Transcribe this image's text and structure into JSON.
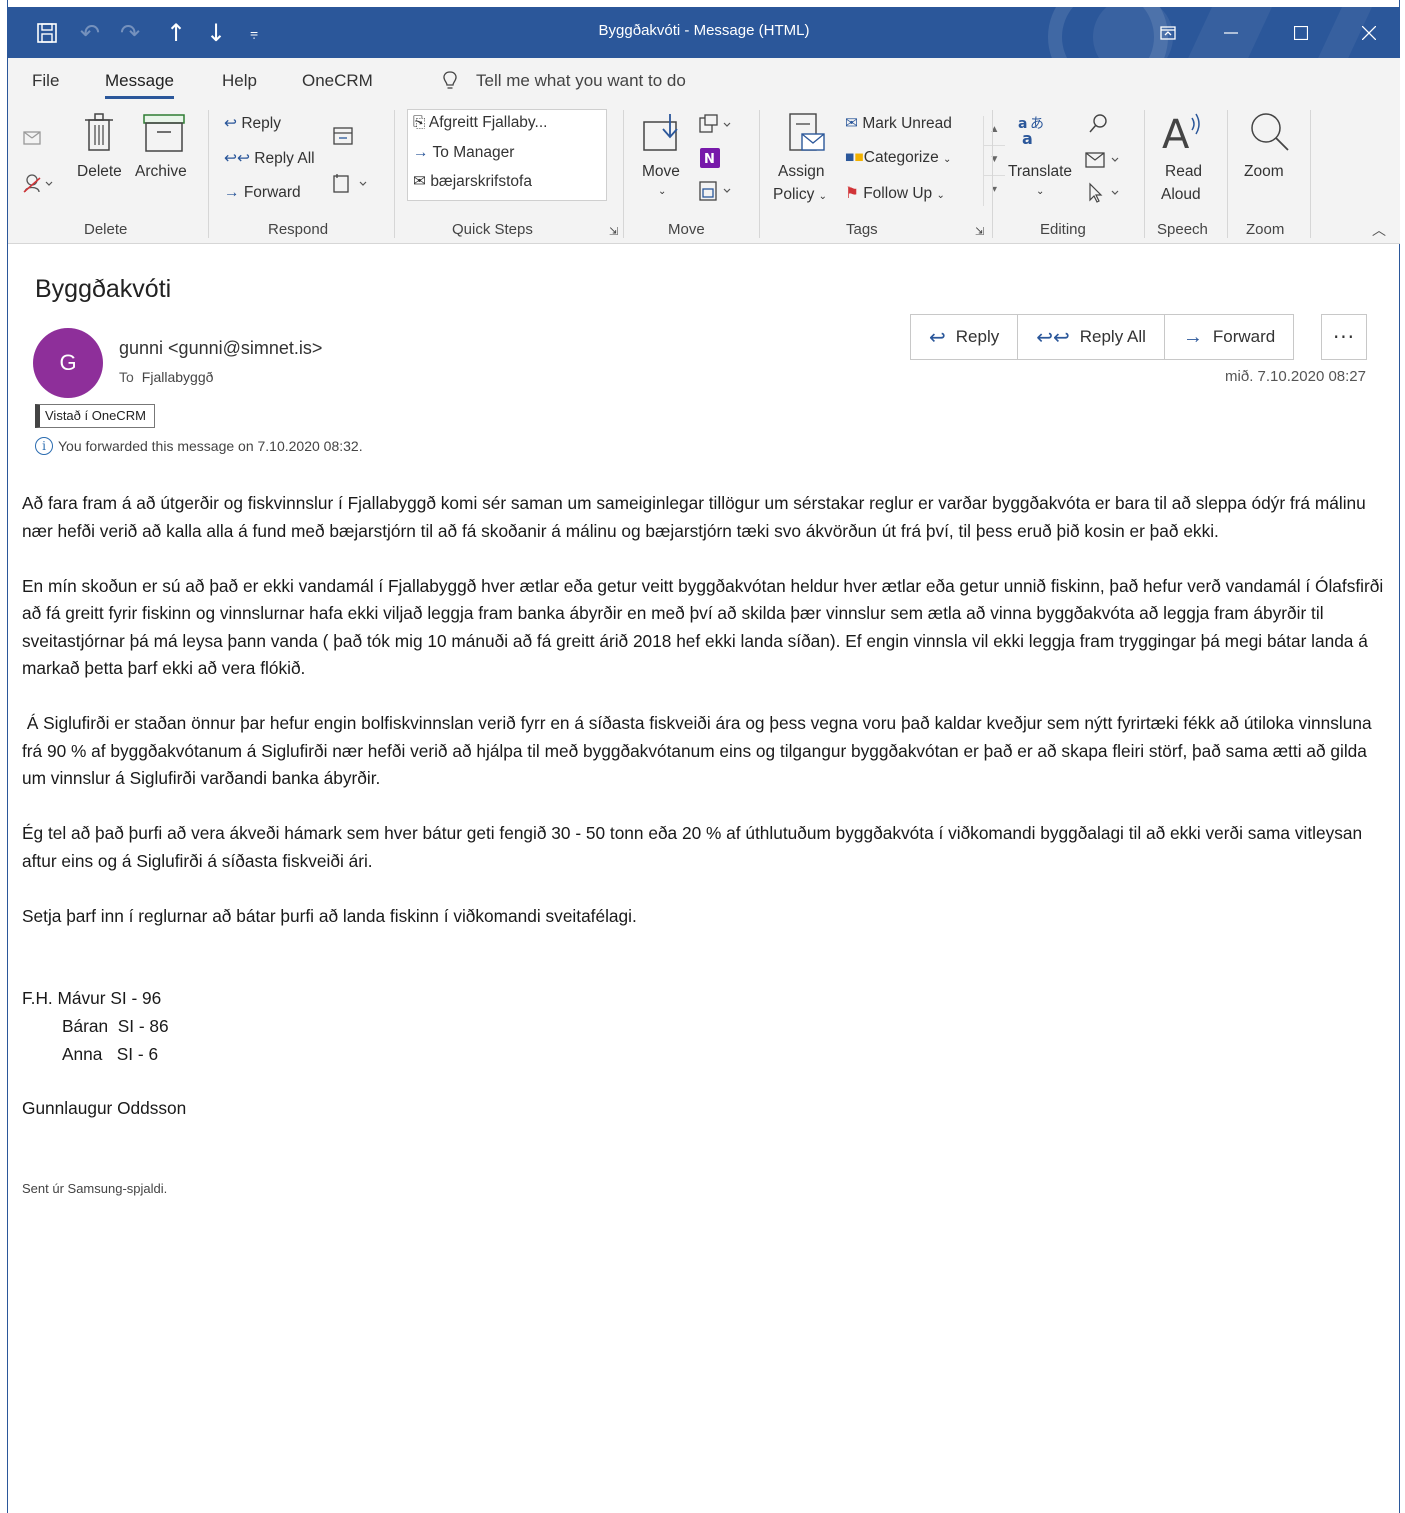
{
  "window": {
    "title": "Byggðakvóti  -  Message (HTML)"
  },
  "quick_access": [
    "save-icon",
    "undo-icon",
    "redo-icon",
    "up-arrow-icon",
    "down-arrow-icon",
    "customize-icon"
  ],
  "window_controls": [
    "ribbon-display-icon",
    "minimize-icon",
    "maximize-icon",
    "close-icon"
  ],
  "menu": {
    "tabs": [
      "File",
      "Message",
      "Help",
      "OneCRM"
    ],
    "active": "Message",
    "tell_me": "Tell me what you want to do"
  },
  "ribbon": {
    "delete": {
      "delete": "Delete",
      "archive": "Archive",
      "group": "Delete"
    },
    "respond": {
      "reply": "Reply",
      "reply_all": "Reply All",
      "forward": "Forward",
      "group": "Respond"
    },
    "quick_steps": {
      "items": [
        "Afgreitt Fjallaby...",
        "To Manager",
        "bæjarskrifstofa"
      ],
      "group": "Quick Steps"
    },
    "move": {
      "move": "Move",
      "group": "Move"
    },
    "tags": {
      "assign": "Assign",
      "policy": "Policy",
      "mark_unread": "Mark Unread",
      "categorize": "Categorize",
      "follow_up": "Follow Up",
      "group": "Tags"
    },
    "editing": {
      "translate": "Translate",
      "group": "Editing"
    },
    "speech": {
      "read": "Read",
      "aloud": "Aloud",
      "group": "Speech"
    },
    "zoom": {
      "zoom": "Zoom",
      "group": "Zoom"
    }
  },
  "message": {
    "subject": "Byggðakvóti",
    "avatar_initial": "G",
    "avatar_color": "#8e2f9a",
    "sender": "gunni <gunni@simnet.is>",
    "to_label": "To",
    "to": "Fjallabyggð",
    "category": "Vistað í OneCRM",
    "info": "You forwarded this message on 7.10.2020 08:32.",
    "date": "mið. 7.10.2020 08:27",
    "actions": {
      "reply": "Reply",
      "reply_all": "Reply All",
      "forward": "Forward",
      "more": "···"
    },
    "paragraphs": [
      "Að fara fram á að útgerðir og fiskvinnslur í Fjallabyggð komi sér saman um sameiginlegar tillögur um sérstakar reglur er varðar byggðakvóta er bara til að sleppa ódýr frá málinu nær hefði verið að kalla alla á fund með bæjarstjórn til að fá skoðanir á málinu og bæjarstjórn tæki svo ákvörðun út frá því, til þess eruð þið kosin er það ekki.",
      "En mín skoðun er sú að það er ekki vandamál í Fjallabyggð hver ætlar eða getur veitt byggðakvótan heldur hver ætlar eða getur unnið fiskinn, það hefur verð vandamál í Ólafsfirði að fá greitt fyrir fiskinn og vinnslurnar hafa ekki viljað leggja fram banka ábyrðir en með því að skilda þær vinnslur sem ætla að vinna byggðakvóta að leggja fram ábyrðir til sveitastjórnar þá má leysa þann vanda ( það tók mig 10 mánuði  að fá greitt árið 2018 hef ekki landa síðan). Ef engin vinnsla vil ekki leggja fram tryggingar þá megi bátar landa á markað þetta þarf ekki að vera flókið.",
      " Á Siglufirði er staðan önnur þar hefur engin bolfiskvinnslan verið fyrr en á síðasta fiskveiði ára og þess vegna voru það kaldar kveðjur sem nýtt fyrirtæki fékk að útiloka vinnsluna frá 90 % af byggðakvótanum á Siglufirði nær hefði verið að hjálpa til með byggðakvótanum eins og tilgangur byggðakvótan er það er að skapa fleiri störf, það sama ætti að gilda um vinnslur á Siglufirði varðandi banka ábyrðir.",
      "Ég tel að það þurfi að vera ákveði hámark sem hver bátur geti fengið 30 - 50 tonn eða 20 % af úthlutuðum byggðakvóta í viðkomandi byggðalagi til að ekki verði sama vitleysan aftur eins og á Siglufirði á síðasta fiskveiði ári.",
      "Setja þarf inn í reglurnar að bátar þurfi að landa fiskinn í viðkomandi sveitafélagi."
    ],
    "boats": [
      "F.H. Mávur SI - 96",
      "Báran  SI - 86",
      "Anna   SI - 6"
    ],
    "signature": "Gunnlaugur Oddsson",
    "sent_from": "Sent úr Samsung-spjaldi."
  }
}
